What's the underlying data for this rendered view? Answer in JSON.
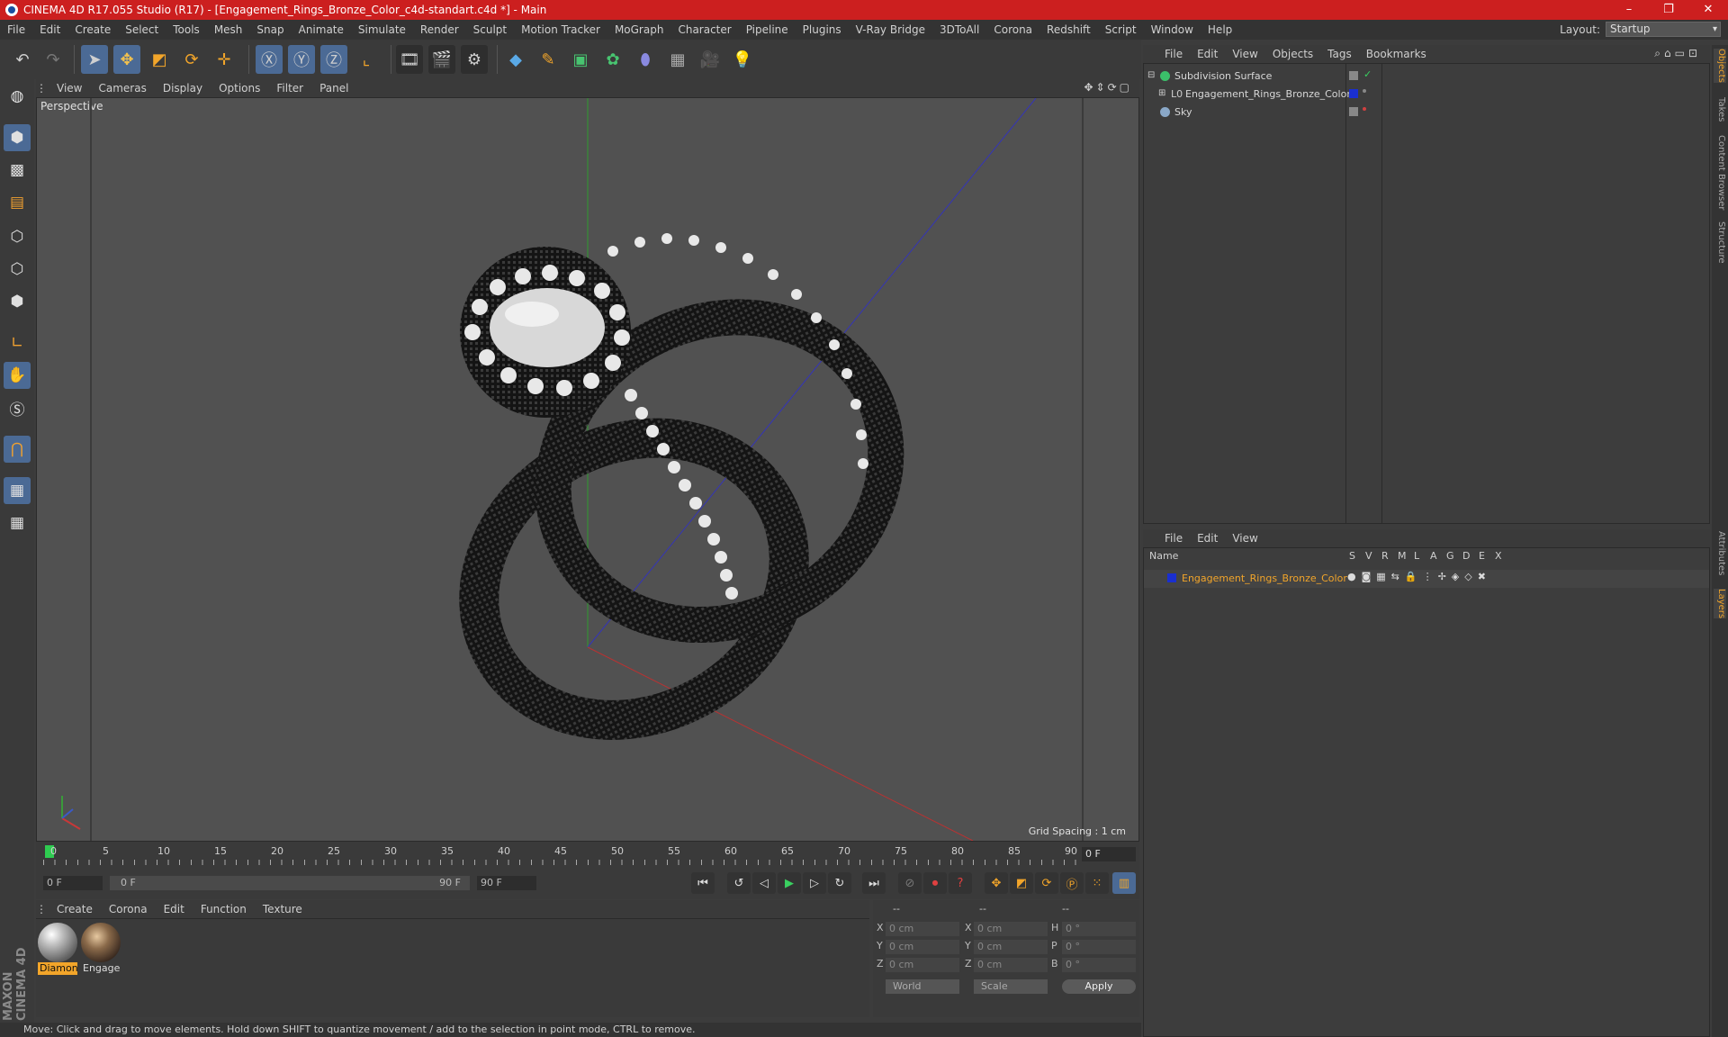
{
  "window": {
    "title": "CINEMA 4D R17.055 Studio (R17) - [Engagement_Rings_Bronze_Color_c4d-standart.c4d *] - Main",
    "controls": [
      "–",
      "❐",
      "✕"
    ]
  },
  "menubar": {
    "items": [
      "File",
      "Edit",
      "Create",
      "Select",
      "Tools",
      "Mesh",
      "Snap",
      "Animate",
      "Simulate",
      "Render",
      "Sculpt",
      "Motion Tracker",
      "MoGraph",
      "Character",
      "Pipeline",
      "Plugins",
      "V-Ray Bridge",
      "3DToAll",
      "Corona",
      "Redshift",
      "Script",
      "Window",
      "Help"
    ],
    "layout_label": "Layout:",
    "layout_value": "Startup"
  },
  "viewport": {
    "menu": [
      "View",
      "Cameras",
      "Display",
      "Options",
      "Filter",
      "Panel"
    ],
    "camera_label": "Perspective",
    "grid_spacing": "Grid Spacing : 1 cm"
  },
  "timeline": {
    "ticks": [
      "0",
      "5",
      "10",
      "15",
      "20",
      "25",
      "30",
      "35",
      "40",
      "45",
      "50",
      "55",
      "60",
      "65",
      "70",
      "75",
      "80",
      "85",
      "90"
    ],
    "current_frame": "0 F",
    "start_field": "0 F",
    "range_start": "0 F",
    "range_end": "90 F",
    "end_field": "90 F"
  },
  "materials": {
    "menu": [
      "Create",
      "Corona",
      "Edit",
      "Function",
      "Texture"
    ],
    "items": [
      {
        "label": "Diamon"
      },
      {
        "label": "Engage"
      }
    ]
  },
  "coordinates": {
    "header": [
      "--",
      "--",
      "--"
    ],
    "rows": [
      {
        "a1": "X",
        "v1": "0 cm",
        "a2": "X",
        "v2": "0 cm",
        "a3": "H",
        "v3": "0 °"
      },
      {
        "a1": "Y",
        "v1": "0 cm",
        "a2": "Y",
        "v2": "0 cm",
        "a3": "P",
        "v3": "0 °"
      },
      {
        "a1": "Z",
        "v1": "0 cm",
        "a2": "Z",
        "v2": "0 cm",
        "a3": "B",
        "v3": "0 °"
      }
    ],
    "mode1": "World",
    "mode2": "Scale",
    "apply": "Apply"
  },
  "status": "Move: Click and drag to move elements. Hold down SHIFT to quantize movement / add to the selection in point mode, CTRL to remove.",
  "objects": {
    "menu": [
      "File",
      "Edit",
      "View",
      "Objects",
      "Tags",
      "Bookmarks"
    ],
    "rows": [
      {
        "name": "Subdivision Surface",
        "color": "#3bbf6a"
      },
      {
        "name": "Engagement_Rings_Bronze_Color",
        "color": "#1a2fd0"
      },
      {
        "name": "Sky",
        "color": "#8aa8c8"
      }
    ]
  },
  "layers": {
    "menu": [
      "File",
      "Edit",
      "View"
    ],
    "columns": [
      "Name",
      "S",
      "V",
      "R",
      "M",
      "L",
      "A",
      "G",
      "D",
      "E",
      "X"
    ],
    "rows": [
      {
        "name": "Engagement_Rings_Bronze_Color",
        "color": "#1a2fd0"
      }
    ]
  },
  "side_tabs": [
    "Objects",
    "Takes",
    "Content Browser",
    "Structure",
    "Attributes",
    "Layers"
  ],
  "brand": "MAXON CINEMA 4D"
}
